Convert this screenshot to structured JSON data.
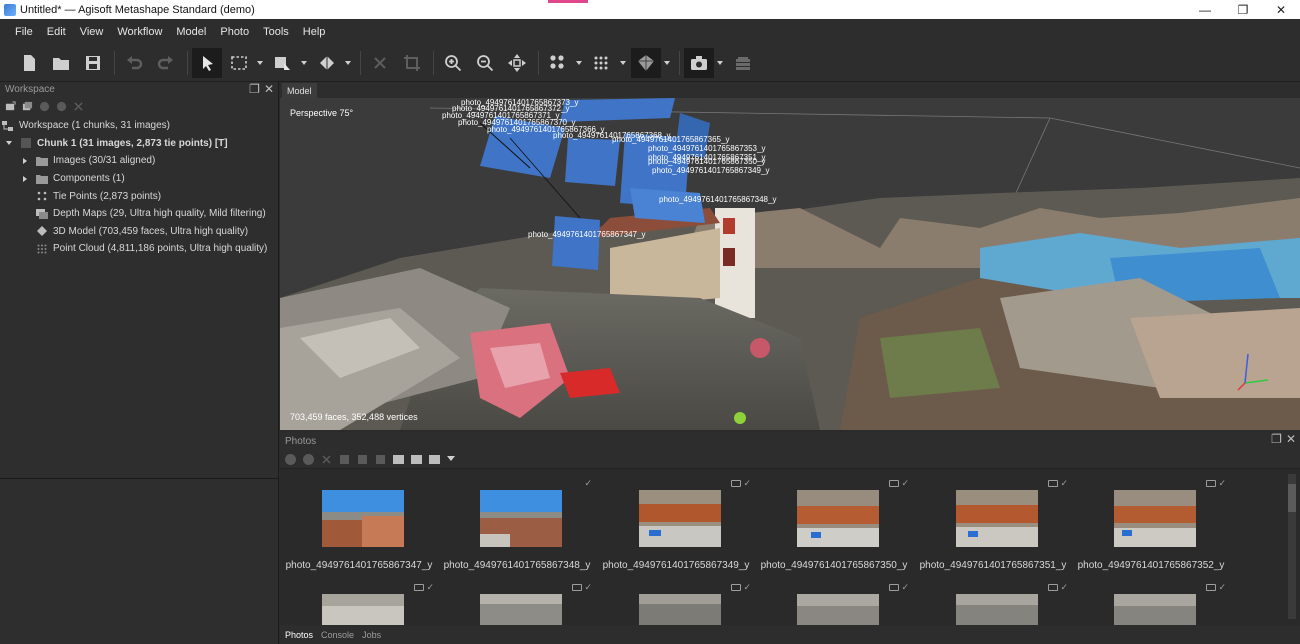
{
  "window": {
    "title": "Untitled* — Agisoft Metashape Standard (demo)",
    "minimize": "—",
    "restore": "❐",
    "close": "✕"
  },
  "menu": [
    {
      "label": "File"
    },
    {
      "label": "Edit"
    },
    {
      "label": "View"
    },
    {
      "label": "Workflow"
    },
    {
      "label": "Model"
    },
    {
      "label": "Photo"
    },
    {
      "label": "Tools"
    },
    {
      "label": "Help"
    }
  ],
  "workspace": {
    "title": "Workspace",
    "items": [
      {
        "label": "Workspace (1 chunks, 31 images)",
        "icon": "workspace-icon"
      },
      {
        "label": "Chunk 1 (31 images, 2,873 tie points) [T]",
        "icon": "chunk-icon"
      },
      {
        "label": "Images (30/31 aligned)",
        "icon": "folder-icon"
      },
      {
        "label": "Components (1)",
        "icon": "folder-icon"
      },
      {
        "label": "Tie Points (2,873 points)",
        "icon": "tie-points-icon"
      },
      {
        "label": "Depth Maps (29, Ultra high quality, Mild filtering)",
        "icon": "depth-maps-icon"
      },
      {
        "label": "3D Model (703,459 faces, Ultra high quality)",
        "icon": "model-icon"
      },
      {
        "label": "Point Cloud (4,811,186 points, Ultra high quality)",
        "icon": "point-cloud-icon"
      }
    ]
  },
  "model": {
    "tab": "Model",
    "perspective": "Perspective 75°",
    "status": "703,459 faces, 352,488 vertices",
    "camera_labels": [
      "photo_4949761401765867373_y",
      "photo_4949761401765867372_y",
      "photo_4949761401765867371_y",
      "photo_4949761401765867370_y",
      "photo_4949761401765867366_y",
      "photo_4949761401765867368_y",
      "photo_4949761401765867365_y",
      "photo_4949761401765867353_y",
      "photo_4949761401765867351_y",
      "photo_4949761401765867350_y",
      "photo_4949761401765867349_y",
      "photo_4949761401765867348_y",
      "photo_4949761401765867347_y"
    ]
  },
  "photos": {
    "title": "Photos",
    "items": [
      {
        "name": "photo_4949761401765867347_y"
      },
      {
        "name": "photo_4949761401765867348_y"
      },
      {
        "name": "photo_4949761401765867349_y"
      },
      {
        "name": "photo_4949761401765867350_y"
      },
      {
        "name": "photo_4949761401765867351_y"
      },
      {
        "name": "photo_4949761401765867352_y"
      }
    ]
  },
  "bottom_tabs": [
    {
      "label": "Photos"
    },
    {
      "label": "Console"
    },
    {
      "label": "Jobs"
    }
  ],
  "colors": {
    "accent": "#e0468c",
    "camera_plane": "#3f74c6",
    "axis_x": "#e03a3a",
    "axis_y": "#2ecc40",
    "axis_z": "#3a5fe0"
  }
}
